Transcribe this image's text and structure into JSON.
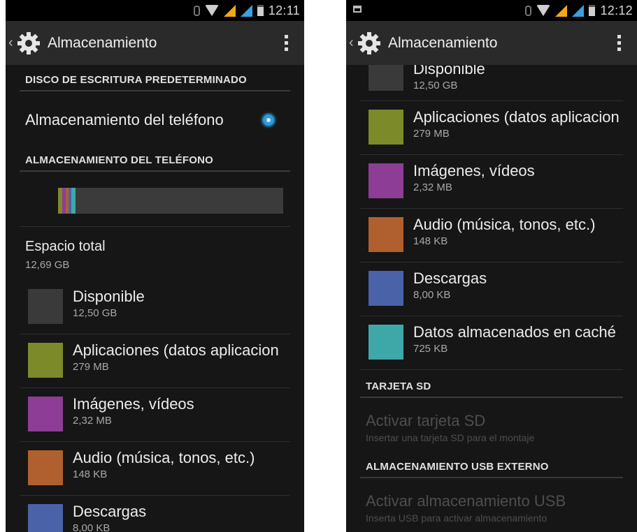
{
  "left": {
    "status": {
      "time": "12:11"
    },
    "actionbar": {
      "title": "Almacenamiento"
    },
    "default_disk_header": "DISCO DE ESCRITURA PREDETERMINADO",
    "default_disk_option": "Almacenamiento del teléfono",
    "phone_storage_header": "ALMACENAMIENTO DEL TELÉFONO",
    "usage_bar": {
      "segments": [
        {
          "name": "aplicaciones",
          "color": "#7d8a2a",
          "fraction": 0.02
        },
        {
          "name": "imagenes",
          "color": "#8e3d96",
          "fraction": 0.015
        },
        {
          "name": "audio",
          "color": "#b0602e",
          "fraction": 0.012
        },
        {
          "name": "descargas",
          "color": "#4a62a8",
          "fraction": 0.012
        },
        {
          "name": "cache",
          "color": "#3ea8a8",
          "fraction": 0.02
        }
      ]
    },
    "total": {
      "label": "Espacio total",
      "value": "12,69 GB"
    },
    "categories": [
      {
        "label": "Disponible",
        "value": "12,50 GB",
        "color": "#3a3a3a"
      },
      {
        "label": "Aplicaciones (datos aplicacion",
        "value": "279 MB",
        "color": "#7d8a2a"
      },
      {
        "label": "Imágenes, vídeos",
        "value": "2,32 MB",
        "color": "#8e3d96"
      },
      {
        "label": "Audio (música, tonos, etc.)",
        "value": "148 KB",
        "color": "#b0602e"
      },
      {
        "label": "Descargas",
        "value": "8,00 KB",
        "color": "#4a62a8"
      }
    ]
  },
  "right": {
    "status": {
      "time": "12:12"
    },
    "actionbar": {
      "title": "Almacenamiento"
    },
    "categories": [
      {
        "label": "Disponible",
        "value": "12,50 GB",
        "color": "#3a3a3a"
      },
      {
        "label": "Aplicaciones (datos aplicacion",
        "value": "279 MB",
        "color": "#7d8a2a"
      },
      {
        "label": "Imágenes, vídeos",
        "value": "2,32 MB",
        "color": "#8e3d96"
      },
      {
        "label": "Audio (música, tonos, etc.)",
        "value": "148 KB",
        "color": "#b0602e"
      },
      {
        "label": "Descargas",
        "value": "8,00 KB",
        "color": "#4a62a8"
      },
      {
        "label": "Datos almacenados en caché",
        "value": "725 KB",
        "color": "#3ea8a8"
      }
    ],
    "sd_header": "TARJETA SD",
    "sd_action": {
      "title": "Activar tarjeta SD",
      "subtitle": "Insertar una tarjeta SD para el montaje"
    },
    "usb_header": "ALMACENAMIENTO USB EXTERNO",
    "usb_action": {
      "title": "Activar almacenamiento USB",
      "subtitle": "Inserta USB para activar almacenamiento"
    }
  }
}
